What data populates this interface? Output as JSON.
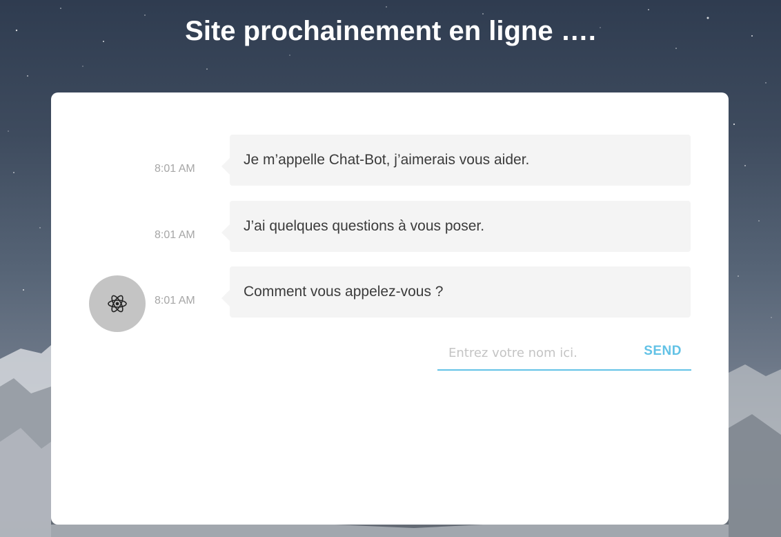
{
  "page": {
    "title": "Site prochainement en ligne …."
  },
  "chat": {
    "messages": [
      {
        "time": "8:01 AM",
        "text": "Je m’appelle Chat-Bot, j’aimerais vous aider."
      },
      {
        "time": "8:01 AM",
        "text": "J’ai quelques questions à vous poser."
      },
      {
        "time": "8:01 AM",
        "text": "Comment vous appelez-vous ?"
      }
    ],
    "bot_avatar_icon": "atom-icon",
    "input": {
      "placeholder": "Entrez votre nom ici.",
      "value": ""
    },
    "send_label": "SEND"
  },
  "colors": {
    "accent": "#62c2e6",
    "bubble_bg": "#f4f4f4",
    "avatar_bg": "#c4c4c4",
    "card_bg": "#ffffff",
    "time_text": "#a6a6a6",
    "message_text": "#3b3b3b"
  }
}
